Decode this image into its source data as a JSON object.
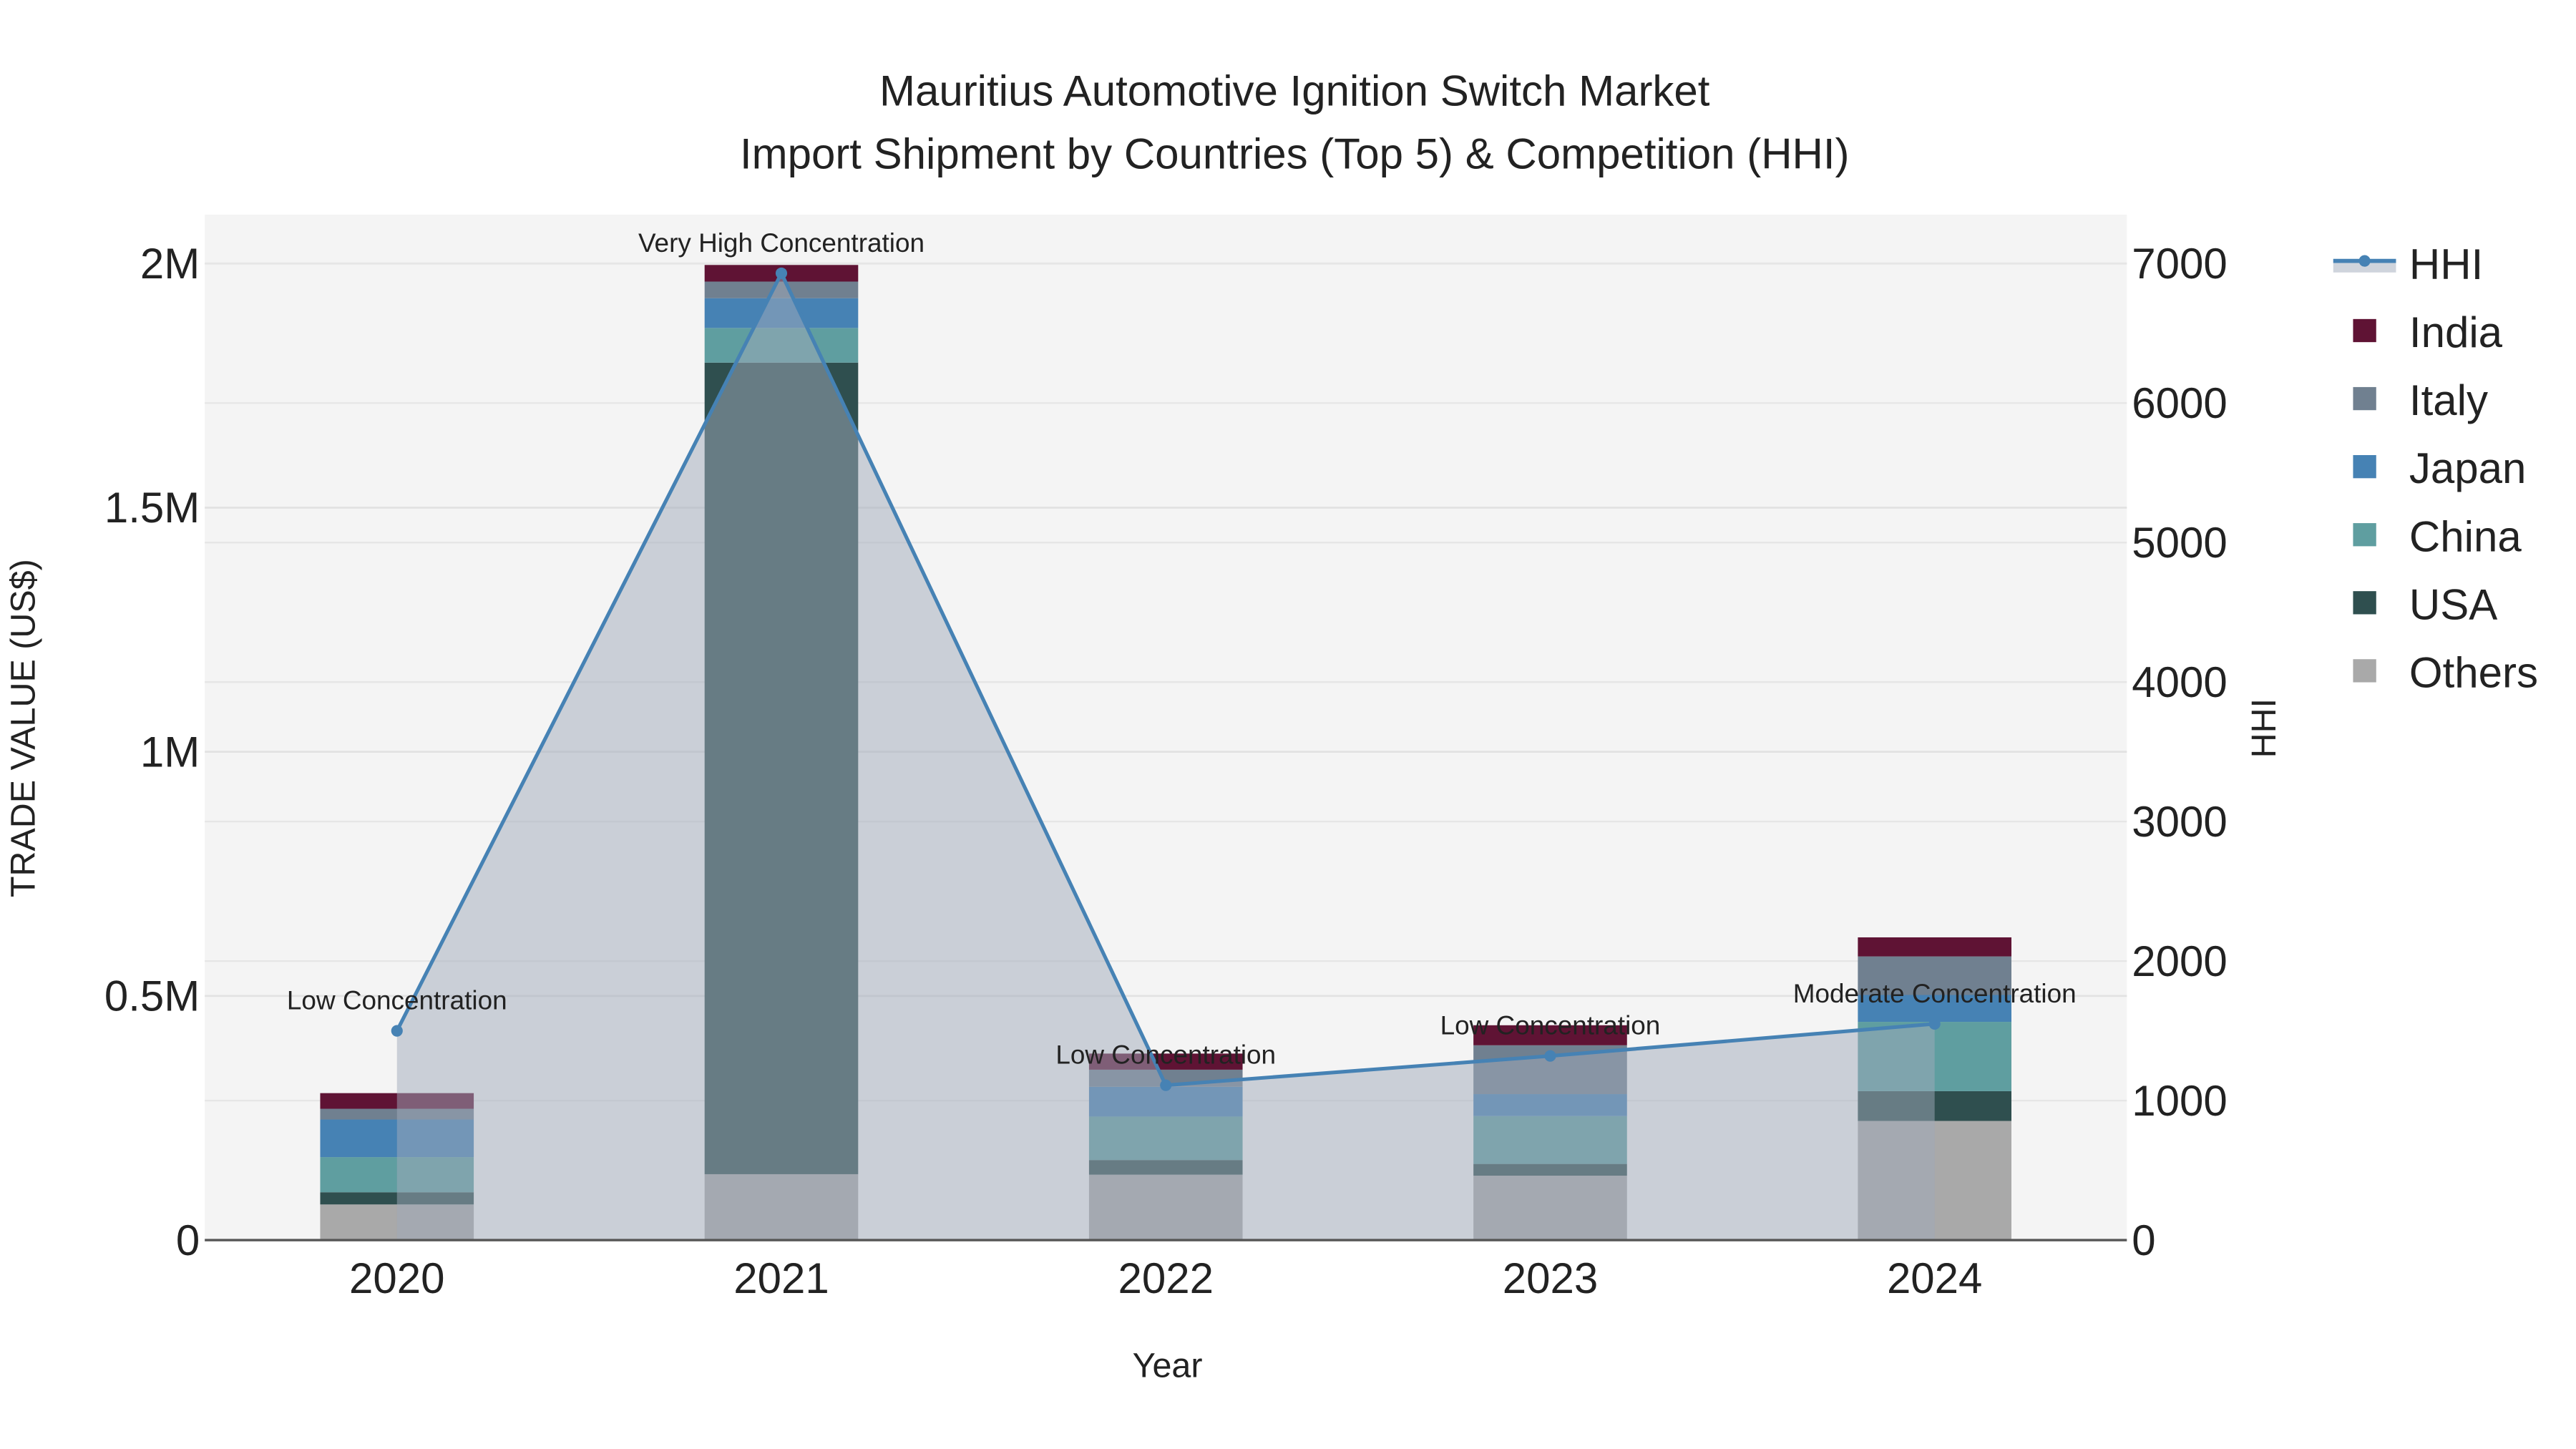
{
  "chart_data": {
    "type": "bar",
    "title_line1": "Mauritius Automotive Ignition Switch Market",
    "title_line2": "Import Shipment by Countries (Top 5) & Competition (HHI)",
    "xlabel": "Year",
    "ylabel": "TRADE VALUE (US$)",
    "y2label": "HHI",
    "categories": [
      "2020",
      "2021",
      "2022",
      "2023",
      "2024"
    ],
    "ylim": [
      0,
      2100000
    ],
    "y2lim": [
      0,
      7350
    ],
    "yticks": [
      {
        "v": 0,
        "label": "0"
      },
      {
        "v": 500000,
        "label": "0.5M"
      },
      {
        "v": 1000000,
        "label": "1M"
      },
      {
        "v": 1500000,
        "label": "1.5M"
      },
      {
        "v": 2000000,
        "label": "2M"
      }
    ],
    "y2ticks": [
      {
        "v": 0,
        "label": "0"
      },
      {
        "v": 1000,
        "label": "1000"
      },
      {
        "v": 2000,
        "label": "2000"
      },
      {
        "v": 3000,
        "label": "3000"
      },
      {
        "v": 4000,
        "label": "4000"
      },
      {
        "v": 5000,
        "label": "5000"
      },
      {
        "v": 6000,
        "label": "6000"
      },
      {
        "v": 7000,
        "label": "7000"
      }
    ],
    "grid": true,
    "legend_position": "right",
    "series": [
      {
        "name": "Others",
        "color": "#a9a9a9",
        "values": [
          73000,
          135000,
          134000,
          132000,
          244000
        ]
      },
      {
        "name": "USA",
        "color": "#2f4f4f",
        "values": [
          25000,
          1662000,
          30000,
          24000,
          61000
        ]
      },
      {
        "name": "China",
        "color": "#5f9ea0",
        "values": [
          72000,
          71000,
          89000,
          98000,
          142000
        ]
      },
      {
        "name": "Japan",
        "color": "#4682b4",
        "values": [
          77000,
          61000,
          61000,
          45000,
          55000
        ]
      },
      {
        "name": "Italy",
        "color": "#708090",
        "values": [
          22000,
          34000,
          35000,
          100000,
          79000
        ]
      },
      {
        "name": "India",
        "color": "#5f1334",
        "values": [
          32000,
          34000,
          33000,
          41000,
          39000
        ]
      }
    ],
    "hhi": {
      "name": "HHI",
      "color": "#4682b4",
      "values": [
        1500,
        6930,
        1110,
        1320,
        1550
      ]
    },
    "annotations": [
      "Low Concentration",
      "Very High Concentration",
      "Low Concentration",
      "Low Concentration",
      "Moderate Concentration"
    ],
    "legend_order": [
      "HHI",
      "India",
      "Italy",
      "Japan",
      "China",
      "USA",
      "Others"
    ]
  }
}
